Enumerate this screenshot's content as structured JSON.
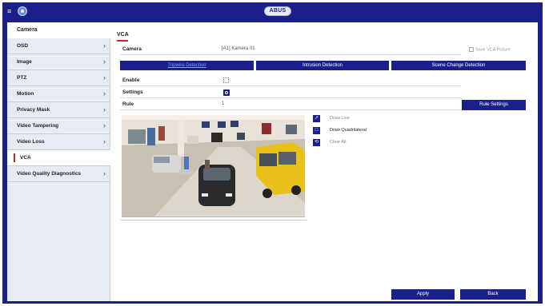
{
  "header": {
    "logo_text": "ABUS",
    "menu_icon": "menu-icon",
    "home_icon": "home-icon"
  },
  "sidebar": {
    "header": "Camera",
    "items": [
      {
        "label": "OSD",
        "chevron": true
      },
      {
        "label": "Image",
        "chevron": true
      },
      {
        "label": "PTZ",
        "chevron": true
      },
      {
        "label": "Motion",
        "chevron": true
      },
      {
        "label": "Privacy Mask",
        "chevron": true
      },
      {
        "label": "Video Tampering",
        "chevron": true
      },
      {
        "label": "Video Loss",
        "chevron": true
      },
      {
        "label": "VCA",
        "chevron": false,
        "active": true
      },
      {
        "label": "Video Quality Diagnostics",
        "chevron": true
      }
    ]
  },
  "main": {
    "title": "VCA",
    "camera_label": "Camera",
    "camera_value": "[A1] Kamera 01",
    "save_vca_label": "Save VCA Picture",
    "tabs": [
      "Tripwire Detection",
      "Intrusion Detection",
      "Scene Change Detection"
    ],
    "active_tab": 0,
    "enable_label": "Enable",
    "settings_label": "Settings",
    "rule_label": "Rule",
    "rule_value": "1",
    "rule_settings_button": "Rule Settings",
    "tools": [
      "Draw Line",
      "Draw Quadrilateral",
      "Clear All"
    ],
    "apply_button": "Apply",
    "back_button": "Back"
  },
  "colors": {
    "accent": "#1a1f8c",
    "active_marker": "#d4231c",
    "sidebar_bg": "#e7ebf6"
  }
}
